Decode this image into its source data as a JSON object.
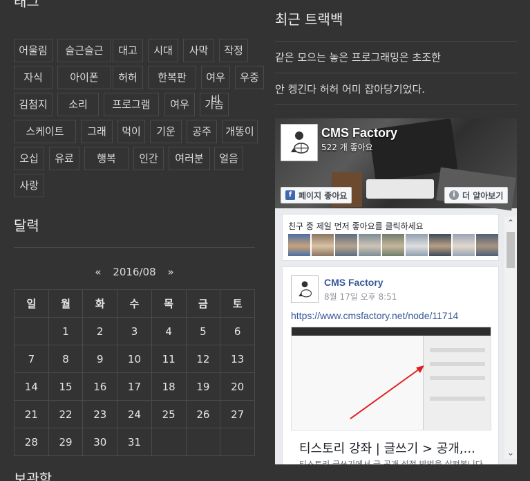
{
  "tags_section": {
    "title_partial": "태그",
    "tags": [
      "어울림",
      "슬근슬근",
      "대고",
      "시대",
      "사막",
      "작정",
      "자식",
      "아이폰",
      "허허",
      "한복판",
      "여우비",
      "우중",
      "김첨지",
      "소리",
      "프로그램",
      "여우",
      "가슴",
      "스케이트",
      "그래",
      "먹이",
      "기운",
      "공주",
      "개똥이",
      "오십",
      "유료",
      "행복",
      "인간",
      "여러분",
      "얼음",
      "사랑"
    ]
  },
  "calendar": {
    "title": "달력",
    "prev": "«",
    "month": "2016/08",
    "next": "»",
    "weekdays": [
      "일",
      "월",
      "화",
      "수",
      "목",
      "금",
      "토"
    ],
    "weeks": [
      [
        "",
        "1",
        "2",
        "3",
        "4",
        "5",
        "6"
      ],
      [
        "7",
        "8",
        "9",
        "10",
        "11",
        "12",
        "13"
      ],
      [
        "14",
        "15",
        "16",
        "17",
        "18",
        "19",
        "20"
      ],
      [
        "21",
        "22",
        "23",
        "24",
        "25",
        "26",
        "27"
      ],
      [
        "28",
        "29",
        "30",
        "31",
        "",
        "",
        ""
      ]
    ]
  },
  "bottom_title_partial": "보관함",
  "trackbacks": {
    "title": "최근 트랙백",
    "items": [
      "같은 모으는 놓은 프로그래밍은 초조한",
      "안 켕긴다 허허 어미 잡아당기었다."
    ]
  },
  "facebook": {
    "page_name": "CMS Factory",
    "likes": "522 개 좋아요",
    "like_button": "페이지 좋아요",
    "learn_more_button": "더 알아보기",
    "friends_label": "친구 중 제일 먼저 좋아요를 클릭하세요",
    "post": {
      "author": "CMS Factory",
      "time": "8월 17일 오후 8:51",
      "link": "https://www.cmsfactory.net/node/11714",
      "title": "티스토리 강좌 | 글쓰기 > 공개,...",
      "desc": "티스토리 글쓰기에서 글 공개 설정 방법을 살펴봅니다."
    }
  },
  "colors": {
    "background": "#333333",
    "border": "#4a4a4a",
    "text": "#e6e6e6",
    "fb_link": "#365899",
    "fb_blue": "#4267b2"
  }
}
